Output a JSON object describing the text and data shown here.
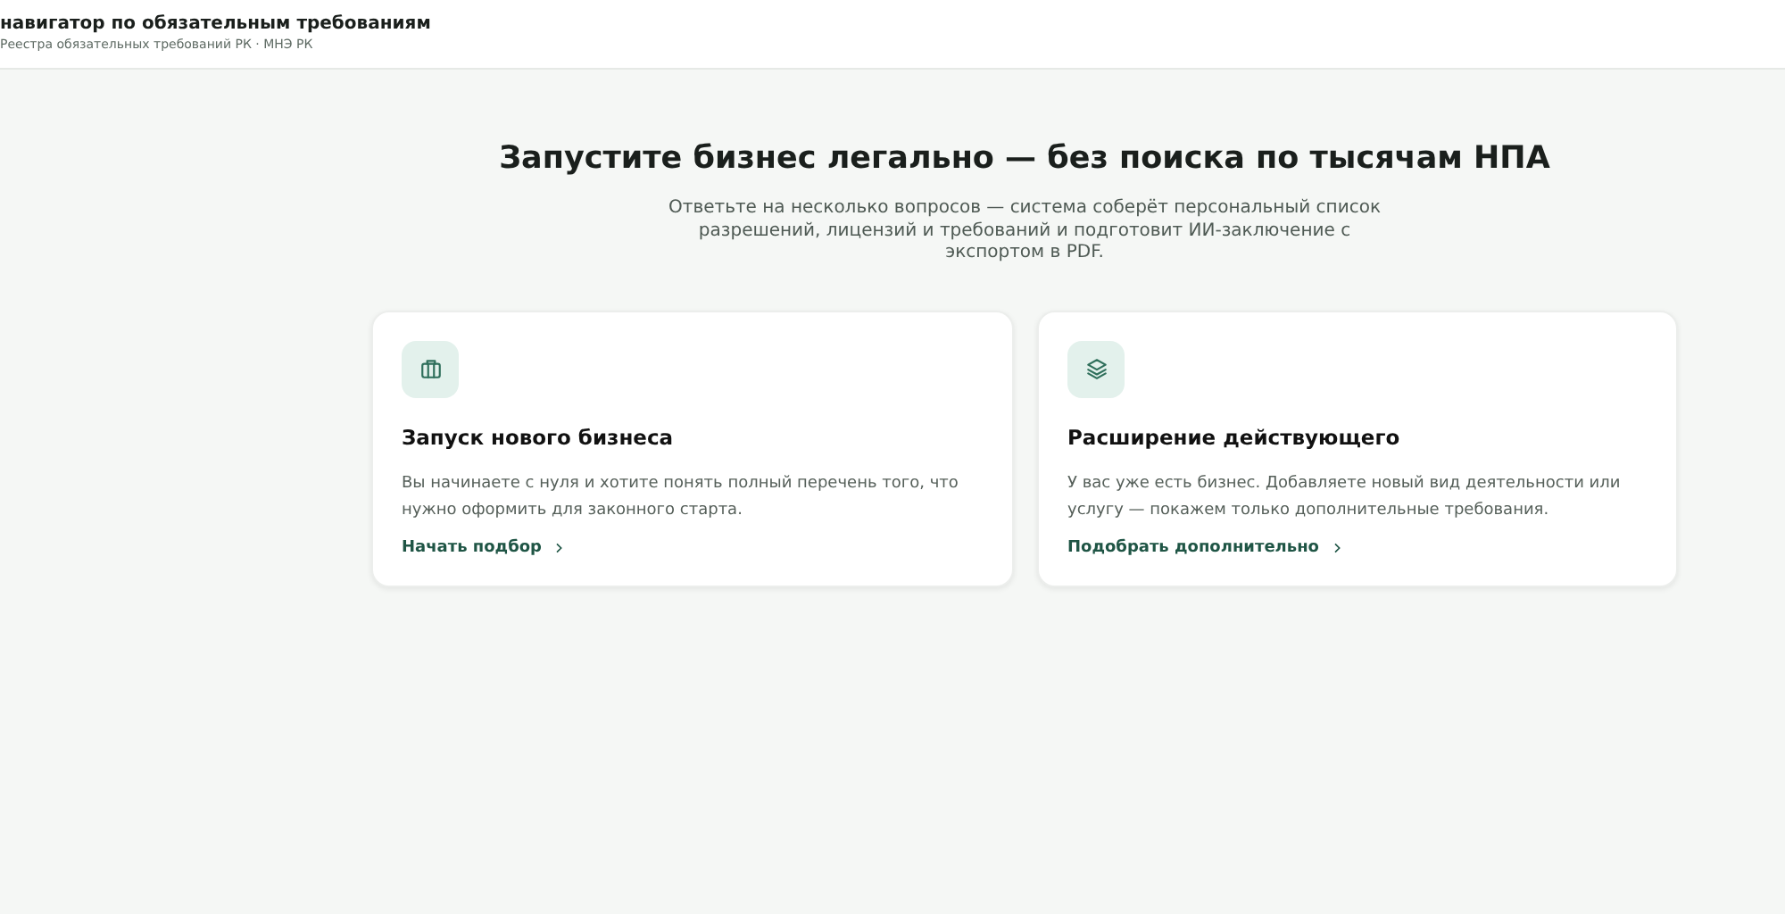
{
  "header": {
    "title": "навигатор по обязательным требованиям",
    "subtitle": "Реестра обязательных требований РК · МНЭ РК"
  },
  "hero": {
    "title": "Запустите бизнес легально — без поиска по тысячам НПА",
    "description": "Ответьте на несколько вопросов — система соберёт персональный список разрешений, лицензий и требований и подготовит ИИ-заключение с экспортом в PDF."
  },
  "cards": [
    {
      "kind": "briefcase",
      "title": "Запуск нового бизнеса",
      "text": "Вы начинаете с нуля и хотите понять полный перечень того, что нужно оформить для законного старта.",
      "link": "Начать подбор"
    },
    {
      "kind": "layers",
      "title": "Расширение действующего",
      "text": "У вас уже есть бизнес. Добавляете новый вид деятельности или услугу — покажем только дополнительные требования.",
      "link": "Подобрать дополнительно"
    }
  ]
}
